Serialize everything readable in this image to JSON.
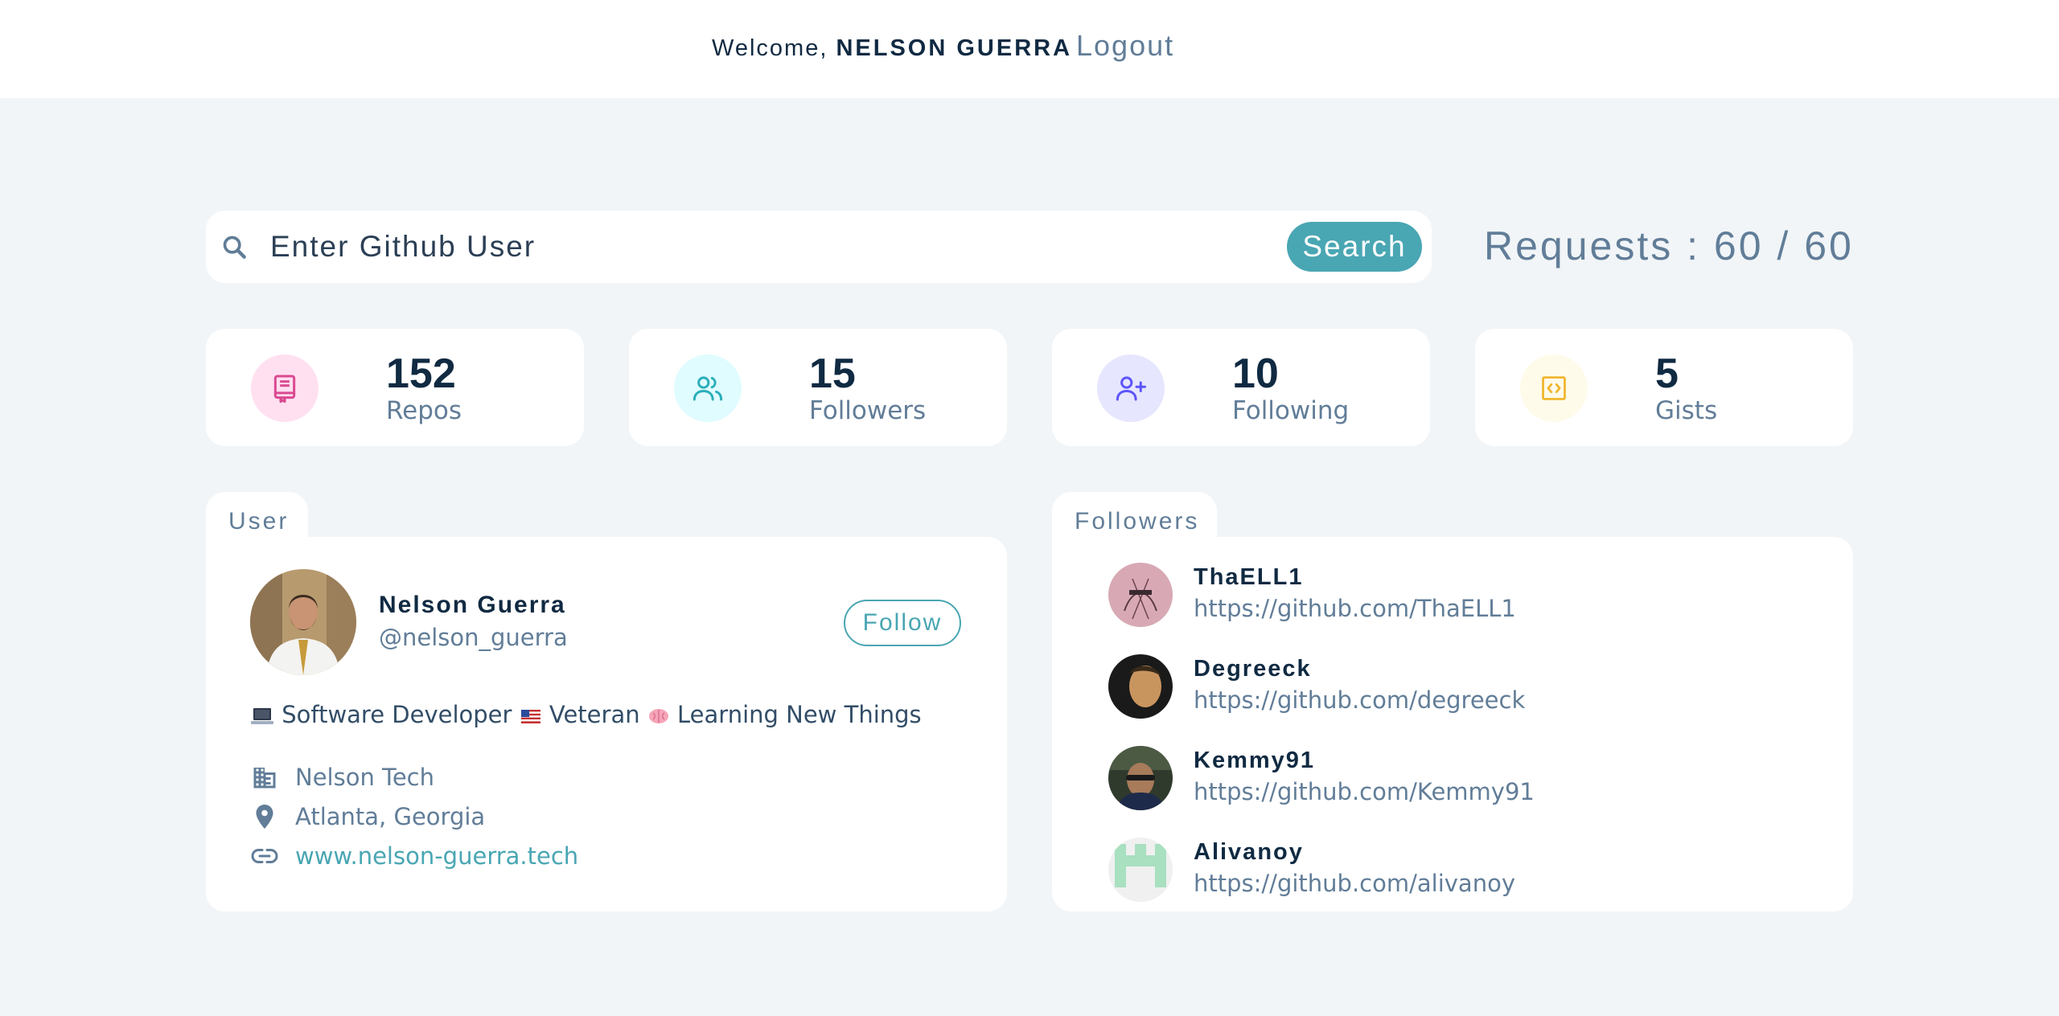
{
  "header": {
    "welcome_prefix": "Welcome,",
    "user_name": "NELSON GUERRA",
    "logout_label": "Logout"
  },
  "search": {
    "placeholder": "Enter Github User",
    "button_label": "Search",
    "requests_text": "Requests : 60 / 60"
  },
  "stats": [
    {
      "value": "152",
      "label": "Repos",
      "icon": "book-icon",
      "color": "#da4a91",
      "bg": "#ffe0f0"
    },
    {
      "value": "15",
      "label": "Followers",
      "icon": "users-icon",
      "color": "#2caeba",
      "bg": "#e0fcff"
    },
    {
      "value": "10",
      "label": "Following",
      "icon": "user-plus-icon",
      "color": "#5d55fa",
      "bg": "#e6e6ff"
    },
    {
      "value": "5",
      "label": "Gists",
      "icon": "code-icon",
      "color": "#f0b429",
      "bg": "#fffbea"
    }
  ],
  "user_panel": {
    "tab_label": "User",
    "name": "Nelson Guerra",
    "handle": "@nelson_guerra",
    "follow_label": "Follow",
    "bio_part1": "Software Developer",
    "bio_part2": "Veteran",
    "bio_part3": "Learning New Things",
    "company": "Nelson Tech",
    "location": "Atlanta, Georgia",
    "blog": "www.nelson-guerra.tech"
  },
  "followers_panel": {
    "tab_label": "Followers",
    "items": [
      {
        "name": "ThaELL1",
        "url": "https://github.com/ThaELL1"
      },
      {
        "name": "Degreeck",
        "url": "https://github.com/degreeck"
      },
      {
        "name": "Kemmy91",
        "url": "https://github.com/Kemmy91"
      },
      {
        "name": "Alivanoy",
        "url": "https://github.com/alivanoy"
      }
    ]
  },
  "colors": {
    "accent": "#49a6b3",
    "background": "#f1f5f8",
    "text_dark": "#102a42",
    "text_muted": "#617d98"
  }
}
